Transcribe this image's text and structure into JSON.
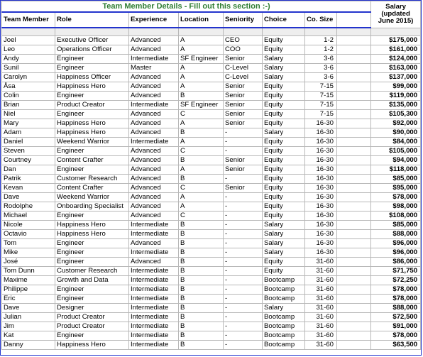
{
  "sheet": {
    "title": "Team Member Details - Fill out this section :-)",
    "salary_header": "Salary (updated June 2015)",
    "salary_header_lines": [
      "Salary",
      "(updated",
      "June 2015)"
    ],
    "columns": [
      "Team Member",
      "Role",
      "Experience",
      "Location",
      "Seniority",
      "Choice",
      "Co. Size",
      "",
      ""
    ],
    "accent_color": "#2233cc",
    "title_color": "#2e7d32",
    "rows": [
      [
        "Joel",
        "Executive Officer",
        "Advanced",
        "A",
        "CEO",
        "Equity",
        "1-2",
        "$175,000"
      ],
      [
        "Leo",
        "Operations Officer",
        "Advanced",
        "A",
        "COO",
        "Equity",
        "1-2",
        "$161,000"
      ],
      [
        "Andy",
        "Engineer",
        "Intermediate",
        "SF Engineer",
        "Senior",
        "Salary",
        "3-6",
        "$124,000"
      ],
      [
        "Sunil",
        "Engineer",
        "Master",
        "A",
        "C-Level",
        "Salary",
        "3-6",
        "$163,000"
      ],
      [
        "Carolyn",
        "Happiness Officer",
        "Advanced",
        "A",
        "C-Level",
        "Salary",
        "3-6",
        "$137,000"
      ],
      [
        "Åsa",
        "Happiness Hero",
        "Advanced",
        "A",
        "Senior",
        "Equity",
        "7-15",
        "$99,000"
      ],
      [
        "Colin",
        "Engineer",
        "Advanced",
        "B",
        "Senior",
        "Equity",
        "7-15",
        "$119,000"
      ],
      [
        "Brian",
        "Product Creator",
        "Intermediate",
        "SF Engineer",
        "Senior",
        "Equity",
        "7-15",
        "$135,000"
      ],
      [
        "Niel",
        "Engineer",
        "Advanced",
        "C",
        "Senior",
        "Equity",
        "7-15",
        "$105,300"
      ],
      [
        "Mary",
        "Happiness Hero",
        "Advanced",
        "A",
        "Senior",
        "Equity",
        "16-30",
        "$92,000"
      ],
      [
        "Adam",
        "Happiness Hero",
        "Advanced",
        "B",
        "-",
        "Salary",
        "16-30",
        "$90,000"
      ],
      [
        "Daniel",
        "Weekend Warrior",
        "Intermediate",
        "A",
        "-",
        "Equity",
        "16-30",
        "$84,000"
      ],
      [
        "Steven",
        "Engineer",
        "Advanced",
        "C",
        "-",
        "Equity",
        "16-30",
        "$105,000"
      ],
      [
        "Courtney",
        "Content Crafter",
        "Advanced",
        "B",
        "Senior",
        "Equity",
        "16-30",
        "$94,000"
      ],
      [
        "Dan",
        "Engineer",
        "Advanced",
        "A",
        "Senior",
        "Equity",
        "16-30",
        "$118,000"
      ],
      [
        "Patrik",
        "Customer Research",
        "Advanced",
        "B",
        "-",
        "Equity",
        "16-30",
        "$85,000"
      ],
      [
        "Kevan",
        "Content Crafter",
        "Advanced",
        "C",
        "Senior",
        "Equity",
        "16-30",
        "$95,000"
      ],
      [
        "Dave",
        "Weekend Warrior",
        "Advanced",
        "A",
        "-",
        "Equity",
        "16-30",
        "$78,000"
      ],
      [
        "Rodolphe",
        "Onboarding Specialist",
        "Advanced",
        "A",
        "-",
        "Equity",
        "16-30",
        "$98,000"
      ],
      [
        "Michael",
        "Engineer",
        "Advanced",
        "C",
        "-",
        "Equity",
        "16-30",
        "$108,000"
      ],
      [
        "Nicole",
        "Happiness Hero",
        "Intermediate",
        "B",
        "-",
        "Salary",
        "16-30",
        "$85,000"
      ],
      [
        "Octavio",
        "Happiness Hero",
        "Intermediate",
        "B",
        "-",
        "Salary",
        "16-30",
        "$88,000"
      ],
      [
        "Tom",
        "Engineer",
        "Advanced",
        "B",
        "-",
        "Salary",
        "16-30",
        "$96,000"
      ],
      [
        "Mike",
        "Engineer",
        "Intermediate",
        "B",
        "-",
        "Salary",
        "16-30",
        "$96,000"
      ],
      [
        "José",
        "Engineer",
        "Advanced",
        "B",
        "-",
        "Equity",
        "31-60",
        "$86,000"
      ],
      [
        "Tom Dunn",
        "Customer Research",
        "Intermediate",
        "B",
        "-",
        "Equity",
        "31-60",
        "$71,750"
      ],
      [
        "Maxime",
        "Growth and Data",
        "Intermediate",
        "B",
        "-",
        "Bootcamp",
        "31-60",
        "$72,250"
      ],
      [
        "Philippe",
        "Engineer",
        "Intermediate",
        "B",
        "-",
        "Bootcamp",
        "31-60",
        "$78,000"
      ],
      [
        "Eric",
        "Engineer",
        "Intermediate",
        "B",
        "-",
        "Bootcamp",
        "31-60",
        "$78,000"
      ],
      [
        "Dave",
        "Designer",
        "Intermediate",
        "B",
        "-",
        "Salary",
        "31-60",
        "$88,000"
      ],
      [
        "Julian",
        "Product Creator",
        "Intermediate",
        "B",
        "-",
        "Bootcamp",
        "31-60",
        "$72,500"
      ],
      [
        "Jim",
        "Product Creator",
        "Intermediate",
        "B",
        "-",
        "Bootcamp",
        "31-60",
        "$91,000"
      ],
      [
        "Kat",
        "Engineer",
        "Intermediate",
        "B",
        "-",
        "Bootcamp",
        "31-60",
        "$78,000"
      ],
      [
        "Danny",
        "Happiness Hero",
        "Intermediate",
        "B",
        "-",
        "Bootcamp",
        "31-60",
        "$63,500"
      ]
    ]
  }
}
